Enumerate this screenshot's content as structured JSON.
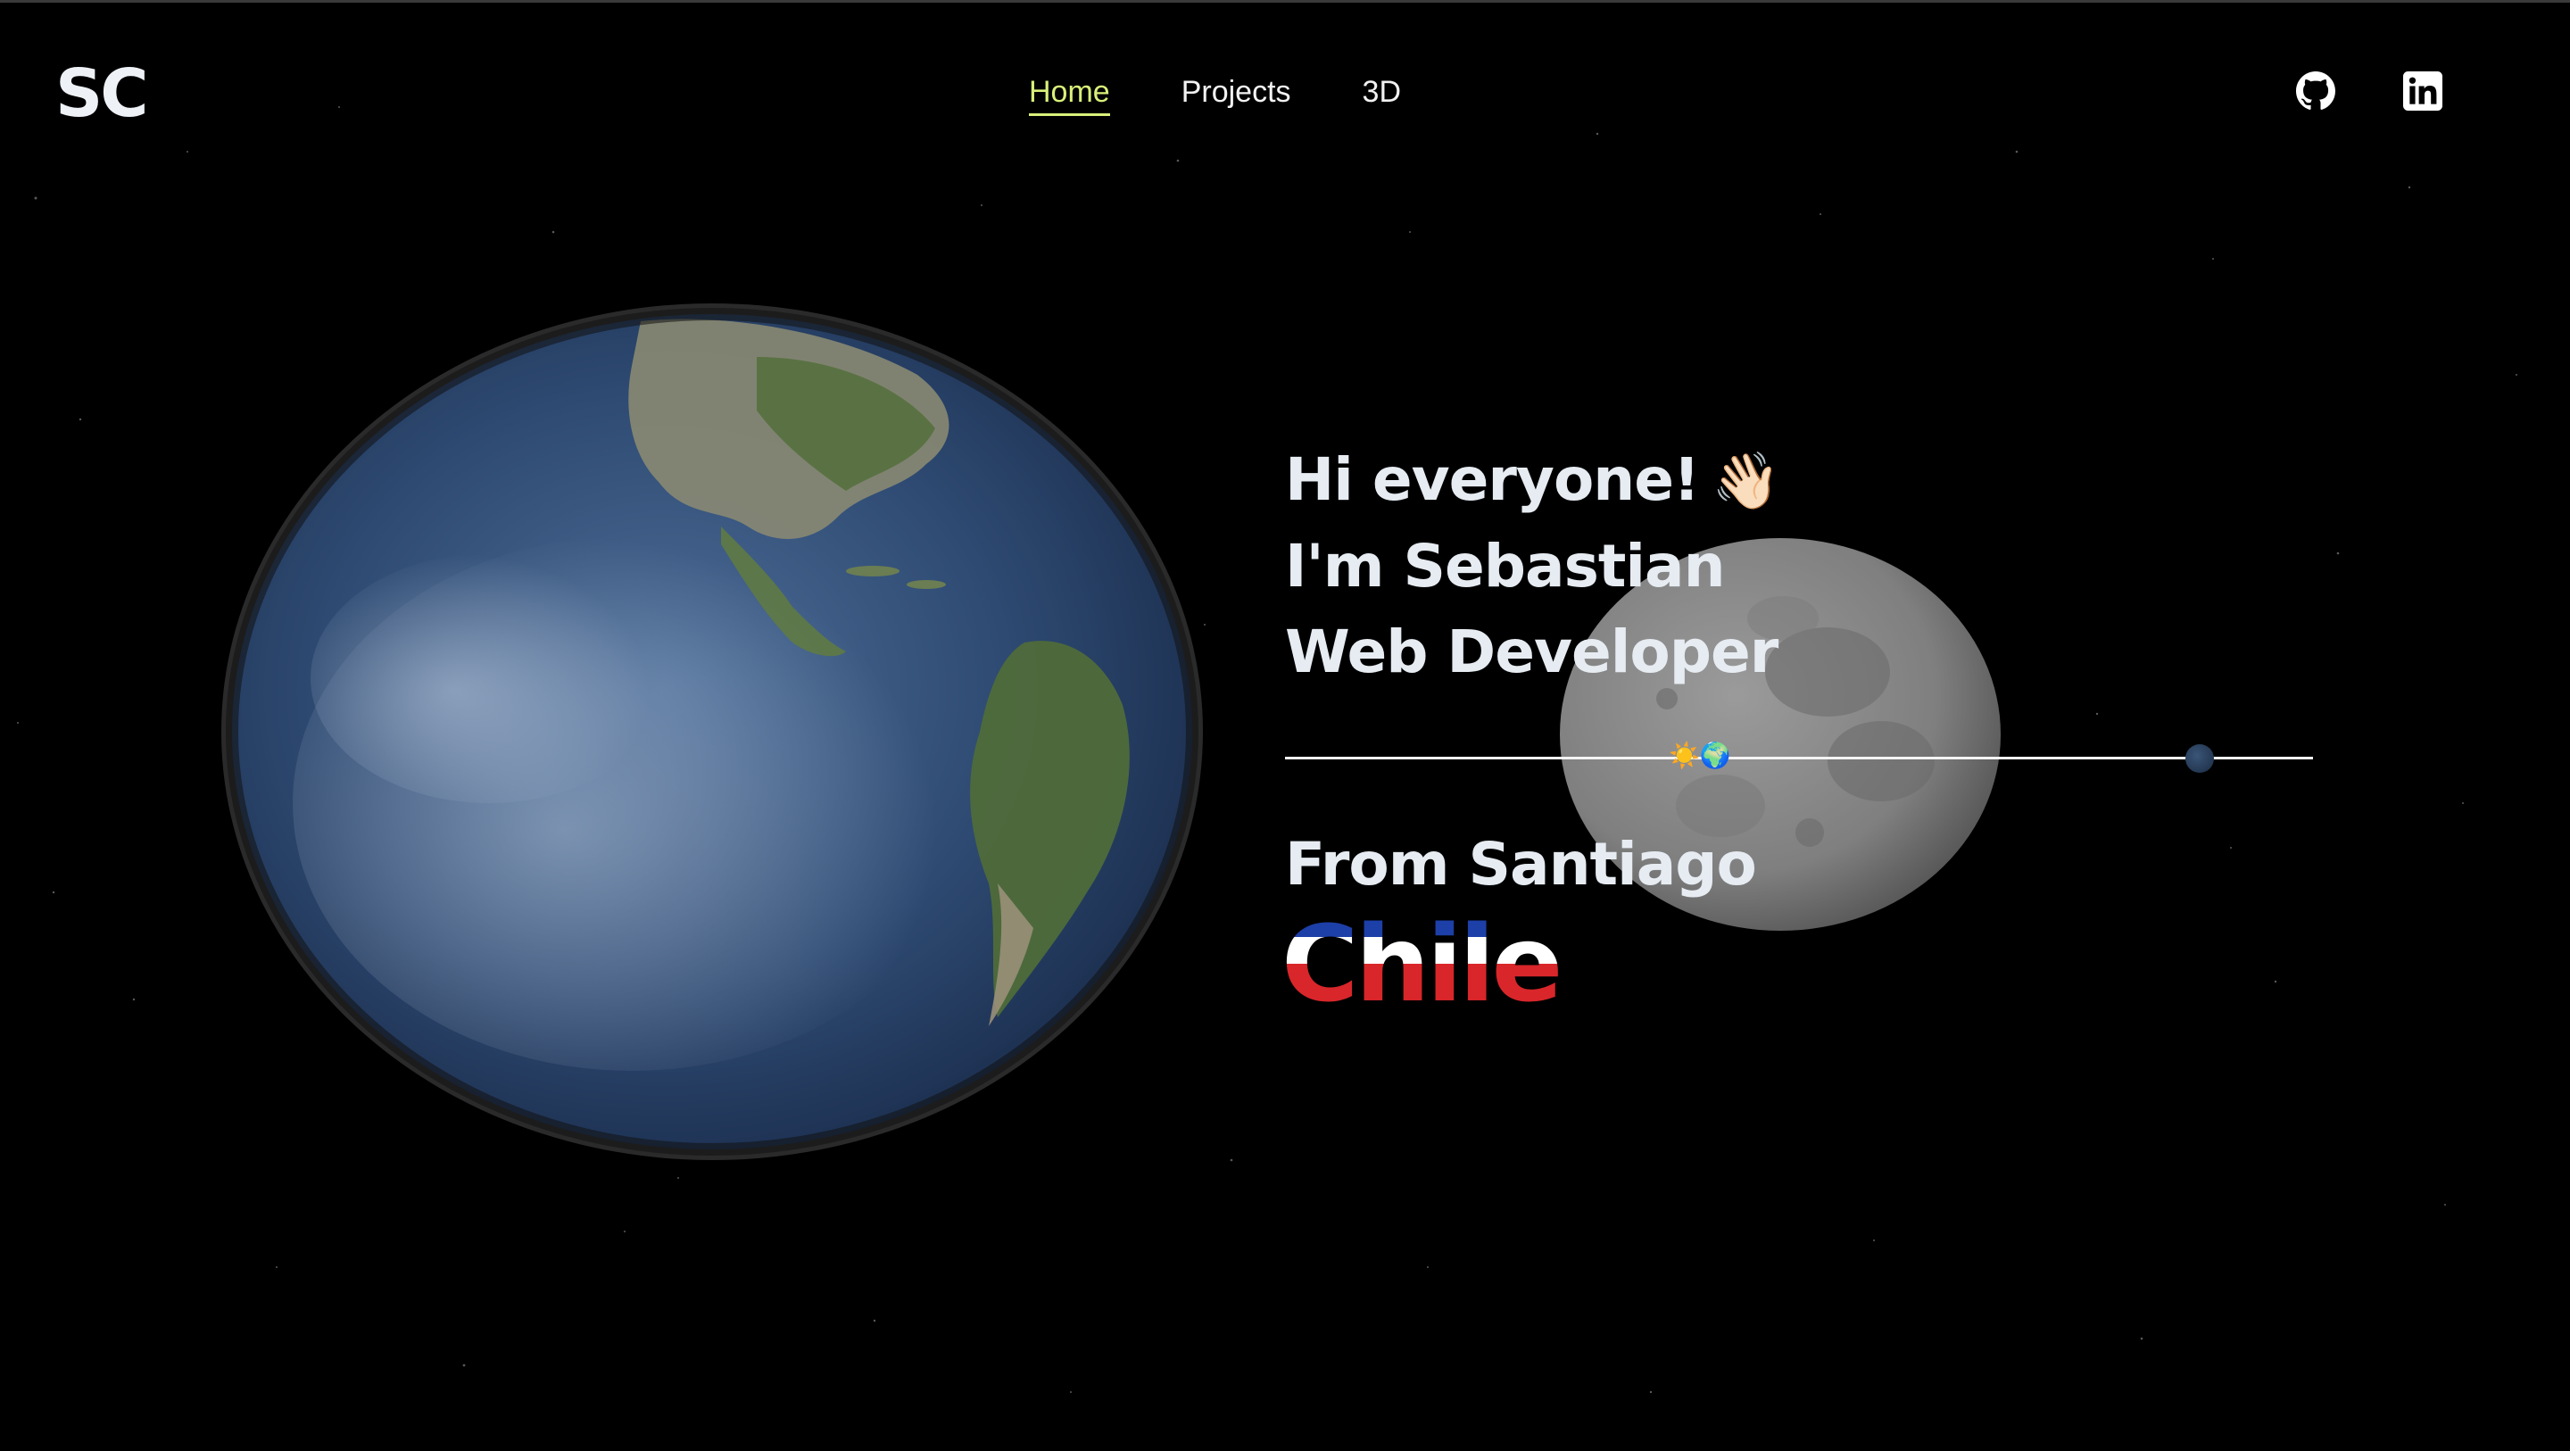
{
  "header": {
    "logo": "SC",
    "nav": [
      {
        "label": "Home",
        "active": true
      },
      {
        "label": "Projects",
        "active": false
      },
      {
        "label": "3D",
        "active": false
      }
    ],
    "social": [
      {
        "icon": "github-icon"
      },
      {
        "icon": "linkedin-icon"
      }
    ]
  },
  "hero": {
    "greeting": "Hi everyone!",
    "wave_emoji": "👋🏻",
    "name_line": "I'm Sebastian",
    "role_line": "Web Developer",
    "sun_earth": "☀️🌍",
    "from_line": "From Santiago",
    "country": "Chile"
  },
  "colors": {
    "background": "#000000",
    "accent": "#d8f07a",
    "text": "#e6ecf2",
    "flag_blue": "#1d3fa8",
    "flag_red": "#d8262a"
  }
}
